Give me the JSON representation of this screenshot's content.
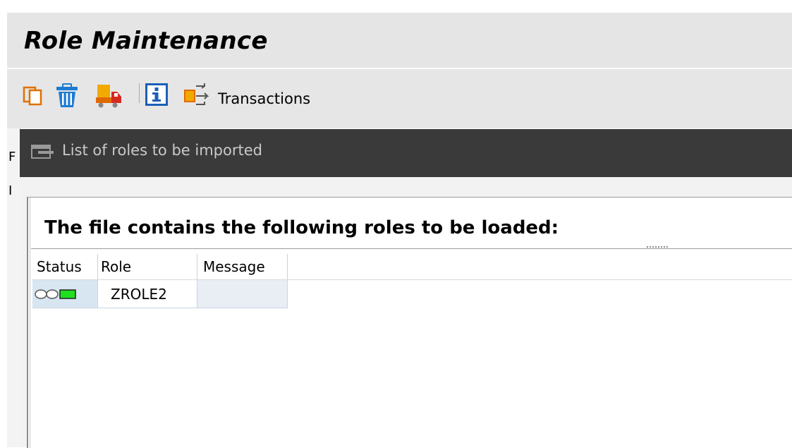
{
  "app": {
    "title": "Role Maintenance"
  },
  "toolbar": {
    "icons": [
      "copy-icon",
      "delete-icon",
      "transport-icon",
      "info-icon",
      "transactions-icon"
    ],
    "transactions_label": "Transactions"
  },
  "background_fragments": [
    "F",
    "I"
  ],
  "dialog": {
    "title": "List of roles to be imported",
    "heading": "The file contains the following roles to be loaded:",
    "table": {
      "columns": [
        "Status",
        "Role",
        "Message"
      ],
      "rows": [
        {
          "status": "green-light",
          "role": "ZROLE2",
          "message": ""
        }
      ]
    }
  },
  "colors": {
    "titlebar": "#3a3a3a",
    "status_green": "#1fe01f",
    "selected_cell": "#d8e6f2"
  }
}
